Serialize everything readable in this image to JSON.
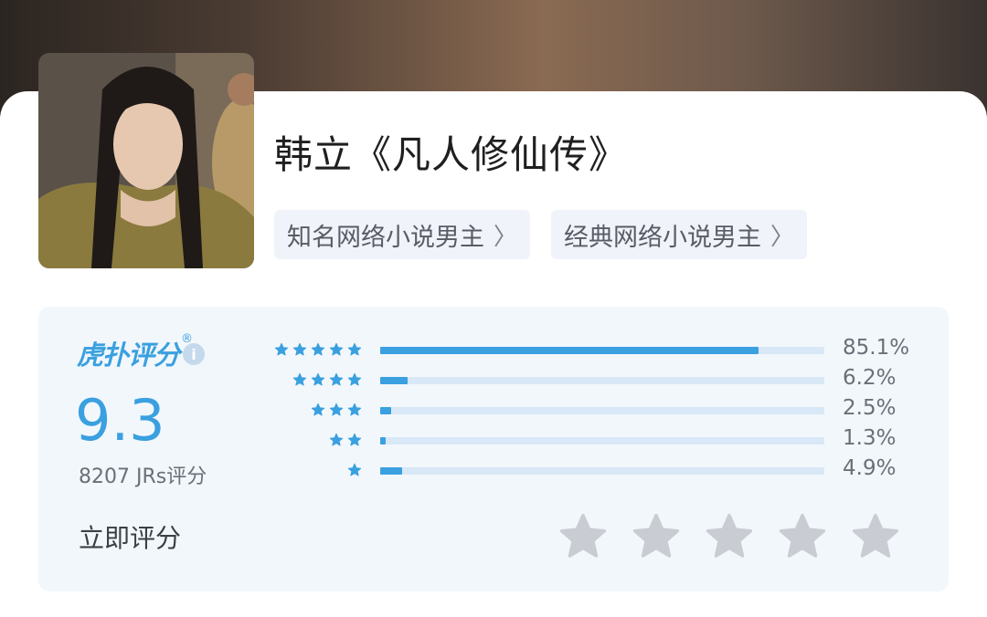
{
  "character": {
    "title": "韩立《凡人修仙传》",
    "tags": [
      {
        "label": "知名网络小说男主"
      },
      {
        "label": "经典网络小说男主"
      }
    ],
    "tag_chevron": "〉"
  },
  "rating": {
    "brand": "虎扑评分",
    "brand_mark": "®",
    "info_icon": "i",
    "score": "9.3",
    "count_label": "8207 JRs评分",
    "rate_now_label": "立即评分",
    "distribution": [
      {
        "stars": 5,
        "percent_label": "85.1%",
        "percent": 85.1
      },
      {
        "stars": 4,
        "percent_label": "6.2%",
        "percent": 6.2
      },
      {
        "stars": 3,
        "percent_label": "2.5%",
        "percent": 2.5
      },
      {
        "stars": 2,
        "percent_label": "1.3%",
        "percent": 1.3
      },
      {
        "stars": 1,
        "percent_label": "4.9%",
        "percent": 4.9
      }
    ],
    "rate_star_count": 5,
    "colors": {
      "accent": "#3aa0df",
      "track": "#d8e8f6",
      "panel": "#f2f7fc",
      "empty_star": "#c9ccd3"
    }
  }
}
